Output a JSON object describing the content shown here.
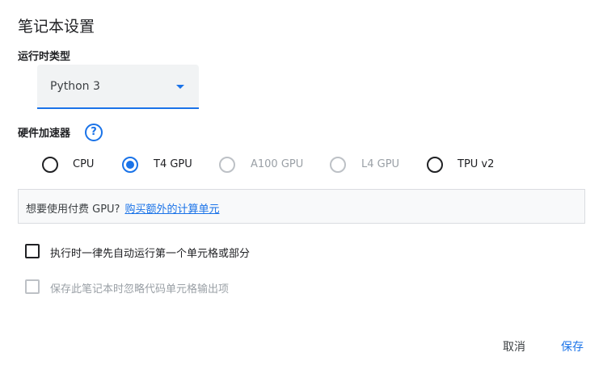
{
  "dialog": {
    "title": "笔记本设置"
  },
  "runtime": {
    "label": "运行时类型",
    "selected": "Python 3"
  },
  "hardware": {
    "label": "硬件加速器",
    "help_icon": "help-circle-icon",
    "options": [
      {
        "label": "CPU",
        "checked": false,
        "disabled": false
      },
      {
        "label": "T4 GPU",
        "checked": true,
        "disabled": false
      },
      {
        "label": "A100 GPU",
        "checked": false,
        "disabled": true
      },
      {
        "label": "L4 GPU",
        "checked": false,
        "disabled": true
      },
      {
        "label": "TPU v2",
        "checked": false,
        "disabled": false
      }
    ]
  },
  "banner": {
    "text": "想要使用付费 GPU?",
    "link": "购买额外的计算单元"
  },
  "checkboxes": [
    {
      "label": "执行时一律先自动运行第一个单元格或部分",
      "checked": false,
      "disabled": false
    },
    {
      "label": "保存此笔记本时忽略代码单元格输出项",
      "checked": false,
      "disabled": true
    }
  ],
  "actions": {
    "cancel": "取消",
    "save": "保存"
  },
  "colors": {
    "accent": "#1a73e8",
    "disabled": "#9aa0a6"
  }
}
